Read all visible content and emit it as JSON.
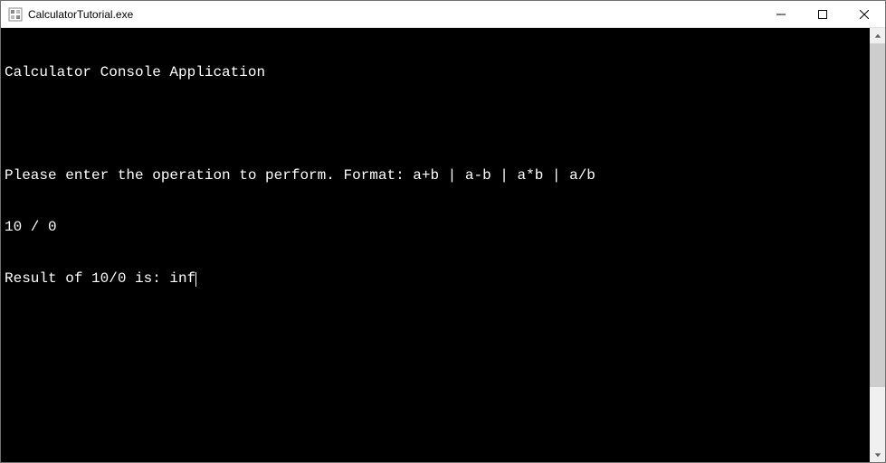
{
  "window": {
    "title": "CalculatorTutorial.exe"
  },
  "console": {
    "lines": [
      "Calculator Console Application",
      "",
      "Please enter the operation to perform. Format: a+b | a-b | a*b | a/b",
      "10 / 0",
      "Result of 10/0 is: inf"
    ]
  }
}
